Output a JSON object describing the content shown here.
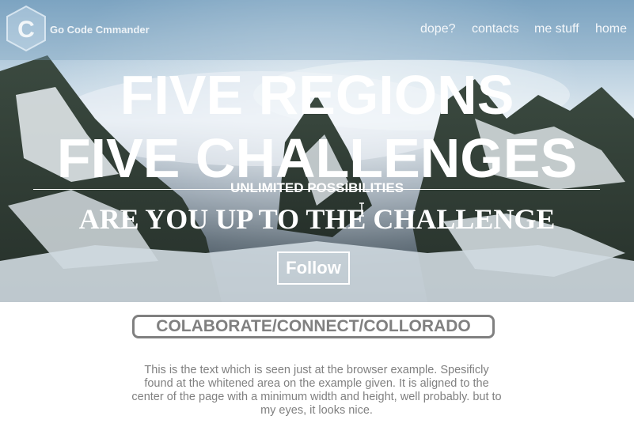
{
  "nav": {
    "brand": "Go Code Cmmander",
    "logo_letter": "C",
    "links": [
      "dope?",
      "contacts",
      "me stuff",
      "home"
    ]
  },
  "hero": {
    "headline_line1": "FIVE REGIONS",
    "headline_line2": "FIVE CHALLENGES",
    "subheading": "UNLIMITED POSSIBILITIES",
    "tagline": "ARE YOU UP TO THE CHALLENGE",
    "follow_label": "Follow"
  },
  "section": {
    "title": "COLABORATE/CONNECT/COLLORADO",
    "body": "This is the text which is seen just at the browser example. Spesificly found at the whitened area on the example given. It is aligned to the center of the page with a minimum width and height, well probably. but to my eyes, it looks nice."
  },
  "colors": {
    "text_gray": "#808080",
    "hero_text": "#ffffff"
  }
}
